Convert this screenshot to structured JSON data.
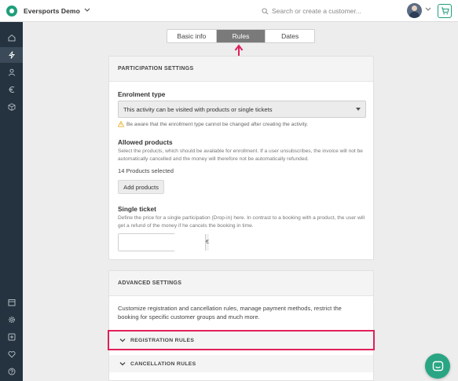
{
  "header": {
    "brand_name": "Eversports Demo",
    "search_placeholder": "Search or create a customer...",
    "colors": {
      "brand": "#1e9e7b",
      "accent_highlight": "#e0205a"
    }
  },
  "sidebar": {
    "items": [
      {
        "icon": "home-icon"
      },
      {
        "icon": "lightning-icon",
        "active": true
      },
      {
        "icon": "person-icon"
      },
      {
        "icon": "euro-icon"
      },
      {
        "icon": "box-icon"
      },
      {
        "icon": "calendar-icon"
      },
      {
        "icon": "gear-icon"
      },
      {
        "icon": "plus-square-icon"
      },
      {
        "icon": "heart-icon"
      },
      {
        "icon": "help-icon"
      }
    ]
  },
  "tabs": [
    {
      "label": "Basic info"
    },
    {
      "label": "Rules",
      "active": true
    },
    {
      "label": "Dates"
    }
  ],
  "participation": {
    "header": "PARTICIPATION SETTINGS",
    "enrolment_type_label": "Enrolment type",
    "enrolment_type_value": "This activity can be visited with products or single tickets",
    "warning": "Be aware that the enrollment type cannot be changed after creating the activity.",
    "allowed_products_label": "Allowed products",
    "allowed_products_desc": "Select the products, which should be available for enrollment. If a user unsubscribes, the invoice will not be automatically cancelled and the money will therefore not be automatically refunded.",
    "products_selected": "14 Products selected",
    "add_products_button": "Add products",
    "single_ticket_label": "Single ticket",
    "single_ticket_desc": "Define the price for a single participation (Drop-in) here. In contrast to a booking with a product, the user will get a refund of the money if he cancels the booking in time.",
    "price_value": "",
    "currency_symbol": "€"
  },
  "advanced": {
    "header": "ADVANCED SETTINGS",
    "description": "Customize registration and cancellation rules, manage payment methods, restrict the booking for specific customer groups and much more.",
    "registration_rules": "REGISTRATION RULES",
    "cancellation_rules": "CANCELLATION RULES"
  }
}
